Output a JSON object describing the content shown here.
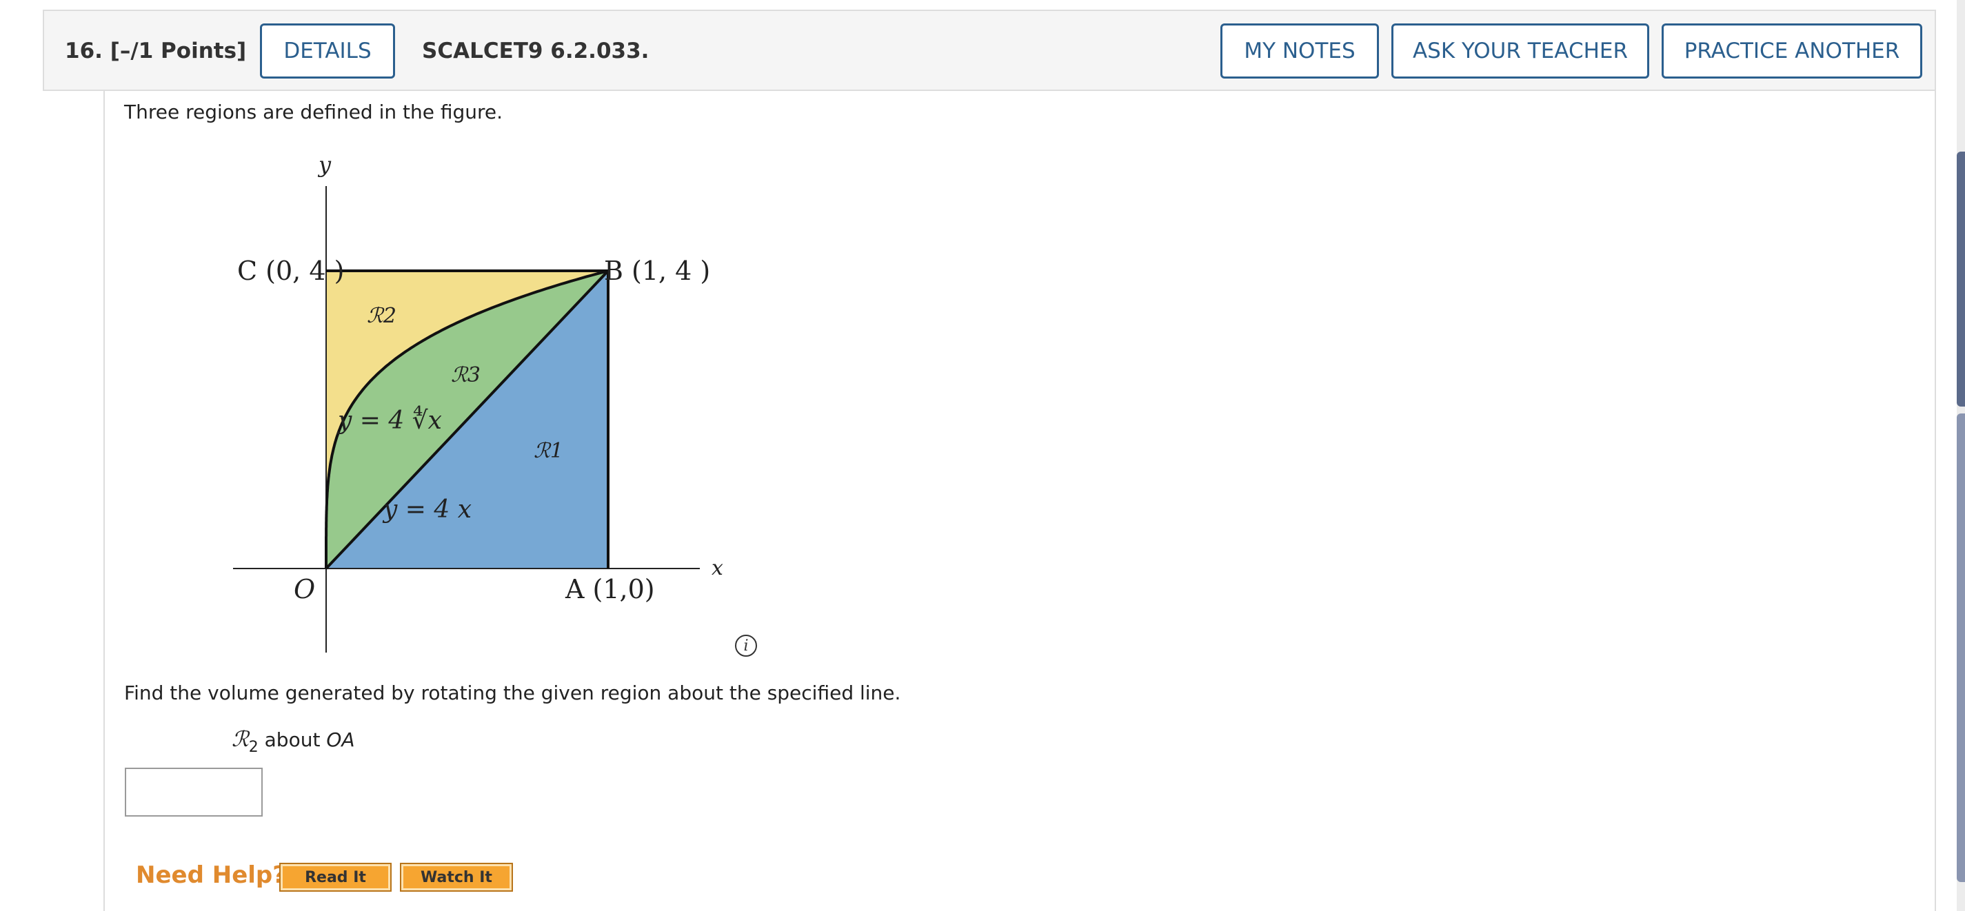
{
  "header": {
    "question_label": "16. [–/1 Points]",
    "details_label": "DETAILS",
    "course_code": "SCALCET9 6.2.033.",
    "my_notes_label": "MY NOTES",
    "ask_teacher_label": "ASK YOUR TEACHER",
    "practice_another_label": "PRACTICE ANOTHER"
  },
  "problem": {
    "intro": "Three regions are defined in the figure.",
    "question": "Find the volume generated by rotating the given region about the specified line.",
    "region_symbol": "ℛ",
    "region_sub": "2",
    "region_about": "about",
    "region_line": "OA"
  },
  "figure": {
    "y_axis": "y",
    "x_axis": "x",
    "point_c": "C (0, 4 )",
    "point_b": "B (1, 4 )",
    "point_o": "O",
    "point_a": "A (1,0)",
    "label_r1": "ℛ1",
    "label_r2": "ℛ2",
    "label_r3": "ℛ3",
    "curve_label": "y = 4 ∜x",
    "line_label": "y = 4 x",
    "colors": {
      "r1": "#77a8d4",
      "r2": "#f3df8c",
      "r3": "#97c98c"
    }
  },
  "info_icon": "i",
  "help": {
    "need_help": "Need Help?",
    "read_it": "Read It",
    "watch_it": "Watch It"
  }
}
